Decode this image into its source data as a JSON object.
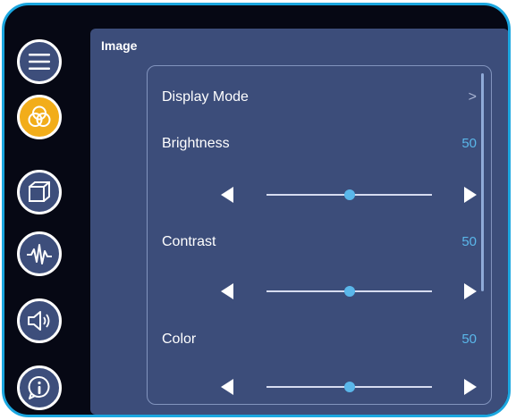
{
  "accent_color": "#f2ad1a",
  "highlight_color": "#5ab7ea",
  "sidebar": {
    "items": [
      {
        "name": "menu-icon",
        "active": false
      },
      {
        "name": "image-color-icon",
        "active": true
      },
      {
        "name": "display-3d-icon",
        "active": false
      },
      {
        "name": "waveform-icon",
        "active": false
      },
      {
        "name": "speaker-icon",
        "active": false
      },
      {
        "name": "info-icon",
        "active": false
      }
    ]
  },
  "panel": {
    "title": "Image",
    "rows": {
      "display_mode": {
        "label": "Display Mode",
        "chevron": ">"
      },
      "brightness": {
        "label": "Brightness",
        "value": "50",
        "fraction": 0.5
      },
      "contrast": {
        "label": "Contrast",
        "value": "50",
        "fraction": 0.5
      },
      "color": {
        "label": "Color",
        "value": "50",
        "fraction": 0.5
      }
    }
  }
}
